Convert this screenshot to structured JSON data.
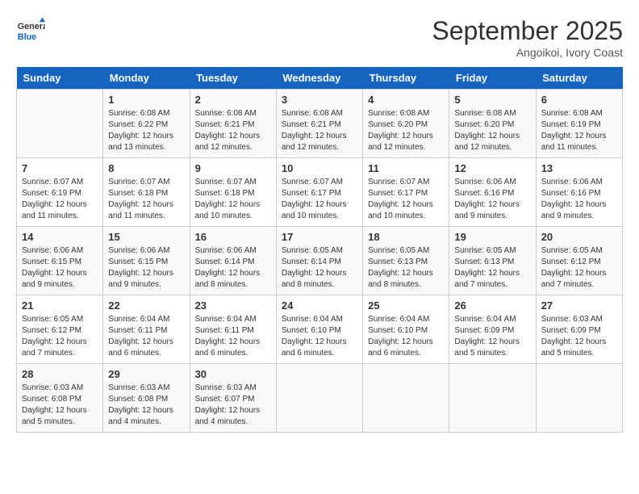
{
  "header": {
    "logo_line1": "General",
    "logo_line2": "Blue",
    "month": "September 2025",
    "location": "Angoikoi, Ivory Coast"
  },
  "weekdays": [
    "Sunday",
    "Monday",
    "Tuesday",
    "Wednesday",
    "Thursday",
    "Friday",
    "Saturday"
  ],
  "weeks": [
    [
      {
        "day": "",
        "info": ""
      },
      {
        "day": "1",
        "info": "Sunrise: 6:08 AM\nSunset: 6:22 PM\nDaylight: 12 hours\nand 13 minutes."
      },
      {
        "day": "2",
        "info": "Sunrise: 6:08 AM\nSunset: 6:21 PM\nDaylight: 12 hours\nand 12 minutes."
      },
      {
        "day": "3",
        "info": "Sunrise: 6:08 AM\nSunset: 6:21 PM\nDaylight: 12 hours\nand 12 minutes."
      },
      {
        "day": "4",
        "info": "Sunrise: 6:08 AM\nSunset: 6:20 PM\nDaylight: 12 hours\nand 12 minutes."
      },
      {
        "day": "5",
        "info": "Sunrise: 6:08 AM\nSunset: 6:20 PM\nDaylight: 12 hours\nand 12 minutes."
      },
      {
        "day": "6",
        "info": "Sunrise: 6:08 AM\nSunset: 6:19 PM\nDaylight: 12 hours\nand 11 minutes."
      }
    ],
    [
      {
        "day": "7",
        "info": "Sunrise: 6:07 AM\nSunset: 6:19 PM\nDaylight: 12 hours\nand 11 minutes."
      },
      {
        "day": "8",
        "info": "Sunrise: 6:07 AM\nSunset: 6:18 PM\nDaylight: 12 hours\nand 11 minutes."
      },
      {
        "day": "9",
        "info": "Sunrise: 6:07 AM\nSunset: 6:18 PM\nDaylight: 12 hours\nand 10 minutes."
      },
      {
        "day": "10",
        "info": "Sunrise: 6:07 AM\nSunset: 6:17 PM\nDaylight: 12 hours\nand 10 minutes."
      },
      {
        "day": "11",
        "info": "Sunrise: 6:07 AM\nSunset: 6:17 PM\nDaylight: 12 hours\nand 10 minutes."
      },
      {
        "day": "12",
        "info": "Sunrise: 6:06 AM\nSunset: 6:16 PM\nDaylight: 12 hours\nand 9 minutes."
      },
      {
        "day": "13",
        "info": "Sunrise: 6:06 AM\nSunset: 6:16 PM\nDaylight: 12 hours\nand 9 minutes."
      }
    ],
    [
      {
        "day": "14",
        "info": "Sunrise: 6:06 AM\nSunset: 6:15 PM\nDaylight: 12 hours\nand 9 minutes."
      },
      {
        "day": "15",
        "info": "Sunrise: 6:06 AM\nSunset: 6:15 PM\nDaylight: 12 hours\nand 9 minutes."
      },
      {
        "day": "16",
        "info": "Sunrise: 6:06 AM\nSunset: 6:14 PM\nDaylight: 12 hours\nand 8 minutes."
      },
      {
        "day": "17",
        "info": "Sunrise: 6:05 AM\nSunset: 6:14 PM\nDaylight: 12 hours\nand 8 minutes."
      },
      {
        "day": "18",
        "info": "Sunrise: 6:05 AM\nSunset: 6:13 PM\nDaylight: 12 hours\nand 8 minutes."
      },
      {
        "day": "19",
        "info": "Sunrise: 6:05 AM\nSunset: 6:13 PM\nDaylight: 12 hours\nand 7 minutes."
      },
      {
        "day": "20",
        "info": "Sunrise: 6:05 AM\nSunset: 6:12 PM\nDaylight: 12 hours\nand 7 minutes."
      }
    ],
    [
      {
        "day": "21",
        "info": "Sunrise: 6:05 AM\nSunset: 6:12 PM\nDaylight: 12 hours\nand 7 minutes."
      },
      {
        "day": "22",
        "info": "Sunrise: 6:04 AM\nSunset: 6:11 PM\nDaylight: 12 hours\nand 6 minutes."
      },
      {
        "day": "23",
        "info": "Sunrise: 6:04 AM\nSunset: 6:11 PM\nDaylight: 12 hours\nand 6 minutes."
      },
      {
        "day": "24",
        "info": "Sunrise: 6:04 AM\nSunset: 6:10 PM\nDaylight: 12 hours\nand 6 minutes."
      },
      {
        "day": "25",
        "info": "Sunrise: 6:04 AM\nSunset: 6:10 PM\nDaylight: 12 hours\nand 6 minutes."
      },
      {
        "day": "26",
        "info": "Sunrise: 6:04 AM\nSunset: 6:09 PM\nDaylight: 12 hours\nand 5 minutes."
      },
      {
        "day": "27",
        "info": "Sunrise: 6:03 AM\nSunset: 6:09 PM\nDaylight: 12 hours\nand 5 minutes."
      }
    ],
    [
      {
        "day": "28",
        "info": "Sunrise: 6:03 AM\nSunset: 6:08 PM\nDaylight: 12 hours\nand 5 minutes."
      },
      {
        "day": "29",
        "info": "Sunrise: 6:03 AM\nSunset: 6:08 PM\nDaylight: 12 hours\nand 4 minutes."
      },
      {
        "day": "30",
        "info": "Sunrise: 6:03 AM\nSunset: 6:07 PM\nDaylight: 12 hours\nand 4 minutes."
      },
      {
        "day": "",
        "info": ""
      },
      {
        "day": "",
        "info": ""
      },
      {
        "day": "",
        "info": ""
      },
      {
        "day": "",
        "info": ""
      }
    ]
  ]
}
